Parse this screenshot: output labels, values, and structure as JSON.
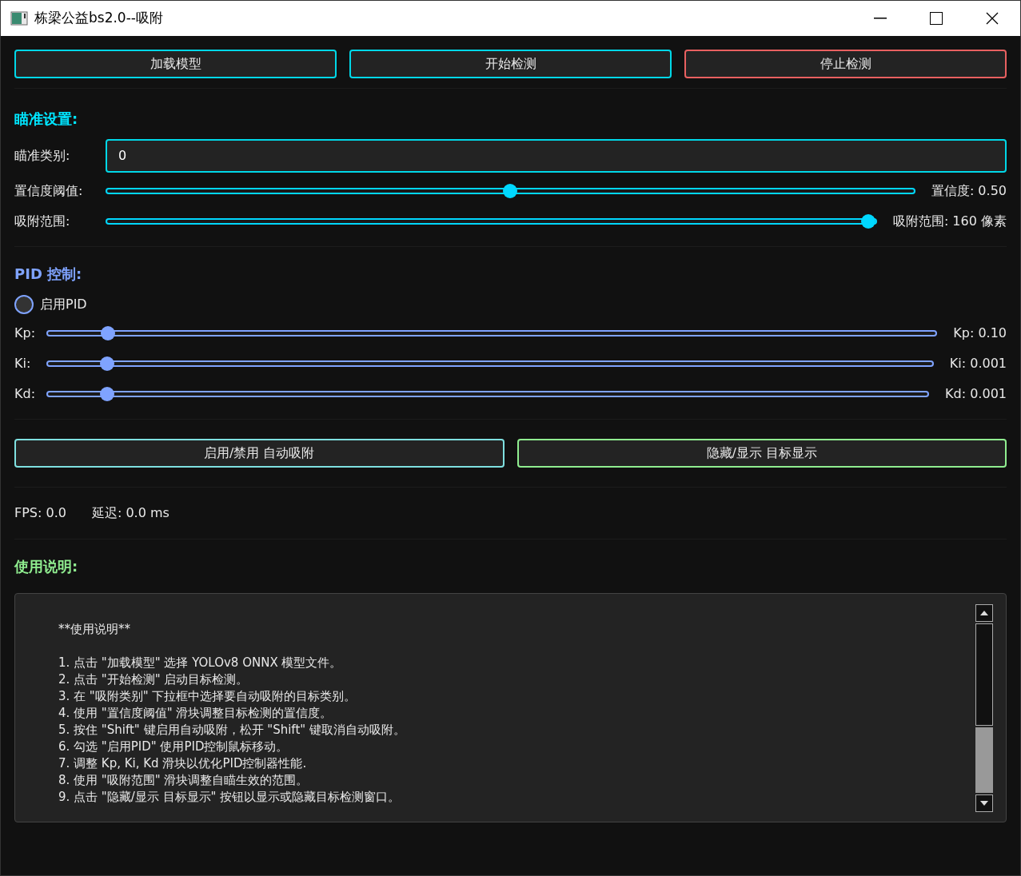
{
  "window": {
    "title": "栋梁公益bs2.0--吸附"
  },
  "top_buttons": [
    {
      "label": "加载模型",
      "color": "#00d8e8"
    },
    {
      "label": "开始检测",
      "color": "#00d8e8"
    },
    {
      "label": "停止检测",
      "color": "#e86060"
    }
  ],
  "aim_settings": {
    "heading": "瞄准设置:",
    "class_label": "瞄准类别:",
    "class_value": "0",
    "sliders": [
      {
        "label": "置信度阈值:",
        "level": 0.5,
        "reading": "置信度: 0.50"
      },
      {
        "label": "吸附范围:",
        "level": 1.0,
        "reading": "吸附范围: 160 像素"
      }
    ]
  },
  "pid": {
    "heading": "PID 控制:",
    "enable": {
      "label": "启用PID",
      "checked": false
    },
    "sliders": [
      {
        "label": "Kp:",
        "level": 0.06,
        "reading": "Kp: 0.10"
      },
      {
        "label": "Ki:",
        "level": 0.06,
        "reading": "Ki: 0.001"
      },
      {
        "label": "Kd:",
        "level": 0.06,
        "reading": "Kd: 0.001"
      }
    ]
  },
  "action_buttons": [
    {
      "label": "启用/禁用 自动吸附",
      "color": "#7fe0e0"
    },
    {
      "label": "隐藏/显示 目标显示",
      "color": "#90ee90"
    }
  ],
  "stats": [
    "FPS: 0.0",
    "延迟: 0.0 ms"
  ],
  "usage": {
    "heading": "使用说明:",
    "title": "**使用说明**",
    "lines": [
      "1. 点击 \"加载模型\" 选择 YOLOv8 ONNX 模型文件。",
      "2. 点击 \"开始检测\" 启动目标检测。",
      "3. 在 \"吸附类别\" 下拉框中选择要自动吸附的目标类别。",
      "4. 使用 \"置信度阈值\" 滑块调整目标检测的置信度。",
      "5. 按住 \"Shift\" 键启用自动吸附，松开 \"Shift\" 键取消自动吸附。",
      "6. 勾选 \"启用PID\" 使用PID控制鼠标移动。",
      "7. 调整 Kp, Ki, Kd 滑块以优化PID控制器性能.",
      "8. 使用 \"吸附范围\" 滑块调整自瞄生效的范围。",
      "9. 点击 \"隐藏/显示 目标显示\" 按钮以显示或隐藏目标检测窗口。"
    ]
  }
}
